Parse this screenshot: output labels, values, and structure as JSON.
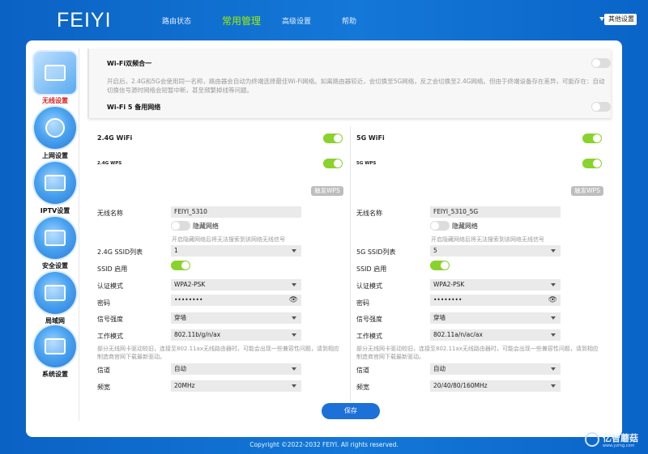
{
  "brand": "FEIYI",
  "nav": {
    "status": "路由状态",
    "common": "常用管理",
    "advanced": "高级设置",
    "help": "帮助",
    "other": "其他设置"
  },
  "sidebar": [
    "无线设置",
    "上网设置",
    "IPTV设置",
    "安全设置",
    "局域网",
    "系统设置"
  ],
  "dual": {
    "title": "Wi-Fi双频合一",
    "desc": "开启后，2.4G和5G会使用同一名称，路由器会自动为终端选择最佳Wi-Fi网络。如离路由器较近，会切换至5G网络，反之会切换至2.4G网络。但由于终端设备存在差异，可能存在：自动切换信号源时网络会短暂中断，甚至频繁掉线等问题。",
    "backup": "Wi-Fi 5 备用网络"
  },
  "left": {
    "band": "2.4G WiFi",
    "wps": "2.4G WPS",
    "wps_btn": "触发WPS",
    "ssid_label": "无线名称",
    "ssid": "FEIYI_5310",
    "hide": "隐藏网络",
    "hide_hint": "开启隐藏网络后将无法搜索到该网络无线信号",
    "list_label": "2.4G SSID列表",
    "list_val": "1",
    "enable_label": "SSID 启用",
    "auth_label": "认证模式",
    "auth": "WPA2-PSK",
    "pwd_label": "密码",
    "pwd": "••••••••",
    "sig_label": "信号强度",
    "sig": "穿墙",
    "mode_label": "工作模式",
    "mode": "802.11b/g/n/ax",
    "compat": "部分无线网卡驱动较旧，连接至802.11ax无线路由器时，可能会出现一些兼容性问题，请到相应制造商官网下载最新驱动。",
    "ch_label": "信道",
    "ch": "自动",
    "bw_label": "频宽",
    "bw": "20MHz"
  },
  "right": {
    "band": "5G WiFi",
    "wps": "5G WPS",
    "wps_btn": "触发WPS",
    "ssid_label": "无线名称",
    "ssid": "FEIYI_5310_5G",
    "hide": "隐藏网络",
    "hide_hint": "开启隐藏网络后将无法搜索到该网络无线信号",
    "list_label": "5G SSID列表",
    "list_val": "5",
    "enable_label": "SSID 启用",
    "auth_label": "认证模式",
    "auth": "WPA2-PSK",
    "pwd_label": "密码",
    "pwd": "••••••••",
    "sig_label": "信号强度",
    "sig": "穿墙",
    "mode_label": "工作模式",
    "mode": "802.11a/n/ac/ax",
    "compat": "部分无线网卡驱动较旧，连接至802.11ax无线路由器时，可能会出现一些兼容性问题，请到相应制造商官网下载最新驱动。",
    "ch_label": "信道",
    "ch": "自动",
    "bw_label": "频宽",
    "bw": "20/40/80/160MHz"
  },
  "save": "保存",
  "footer": "Copyright ©2022-2032 FEIYI. All rights reserved.",
  "watermark": {
    "name": "亿智蘑菇",
    "url": "www.yzmg.com"
  },
  "colors": {
    "accent": "#1c70d8",
    "toggle_on": "#8ad22c",
    "active_nav": "#9ef000",
    "active_side": "#e02020"
  }
}
